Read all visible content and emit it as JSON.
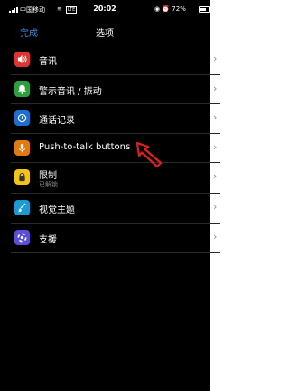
{
  "status_bar": {
    "carrier": "中国移动",
    "network": "LTE",
    "time": "20:02",
    "battery": "72%",
    "battery_level": 0.72
  },
  "nav": {
    "back_label": "完成",
    "title": "选项"
  },
  "menu": [
    {
      "label": "音讯",
      "icon": "speaker-icon",
      "color": "#e0342f"
    },
    {
      "label": "警示音讯 / 振动",
      "icon": "bell-icon",
      "color": "#2f9e3f"
    },
    {
      "label": "通话记录",
      "icon": "history-icon",
      "color": "#1f6fd1"
    },
    {
      "label": "Push-to-talk buttons",
      "icon": "microphone-icon",
      "color": "#e07a16"
    },
    {
      "label": "限制",
      "sublabel": "已解锁",
      "icon": "lock-icon",
      "color": "#f2c318"
    },
    {
      "label": "视觉主题",
      "icon": "paintbrush-icon",
      "color": "#1d9bd1"
    },
    {
      "label": "支援",
      "icon": "lifebuoy-icon",
      "color": "#5a4fd6"
    }
  ],
  "chevron": "›",
  "colors": {
    "accent": "#3b8eea",
    "background": "#000000",
    "pointer": "#e02020"
  }
}
